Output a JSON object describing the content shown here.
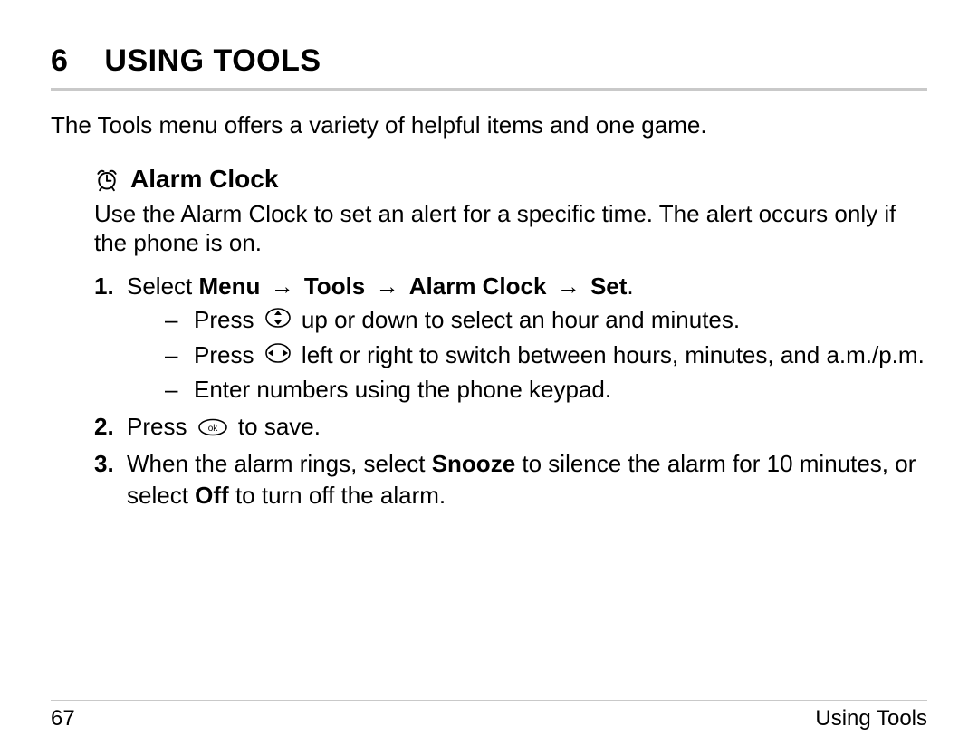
{
  "chapter": {
    "num": "6",
    "title": "USING TOOLS"
  },
  "intro": "The Tools menu offers a variety of helpful items and one game.",
  "section": {
    "title": "Alarm Clock",
    "desc": "Use the Alarm Clock to set an alert for a specific time. The alert occurs only if the phone is on."
  },
  "steps": {
    "s1": {
      "num": "1.",
      "prefix": "Select ",
      "path_menu": "Menu",
      "path_tools": "Tools",
      "path_alarm": "Alarm Clock",
      "path_set": "Set",
      "period": ".",
      "sub1_a": "Press ",
      "sub1_b": " up or down to select an hour and minutes.",
      "sub2_a": "Press ",
      "sub2_b": " left or right to switch between hours, minutes, and a.m./p.m.",
      "sub3": "Enter numbers using the phone keypad."
    },
    "s2": {
      "num": "2.",
      "a": "Press ",
      "b": " to save."
    },
    "s3": {
      "num": "3.",
      "a": "When the alarm rings, select ",
      "snooze": "Snooze",
      "b": " to silence the alarm for 10 minutes, or select ",
      "off": "Off",
      "c": " to turn off the alarm."
    }
  },
  "footer": {
    "page": "67",
    "section": "Using Tools"
  },
  "glyph": {
    "arrow": "→",
    "dash": "–"
  }
}
